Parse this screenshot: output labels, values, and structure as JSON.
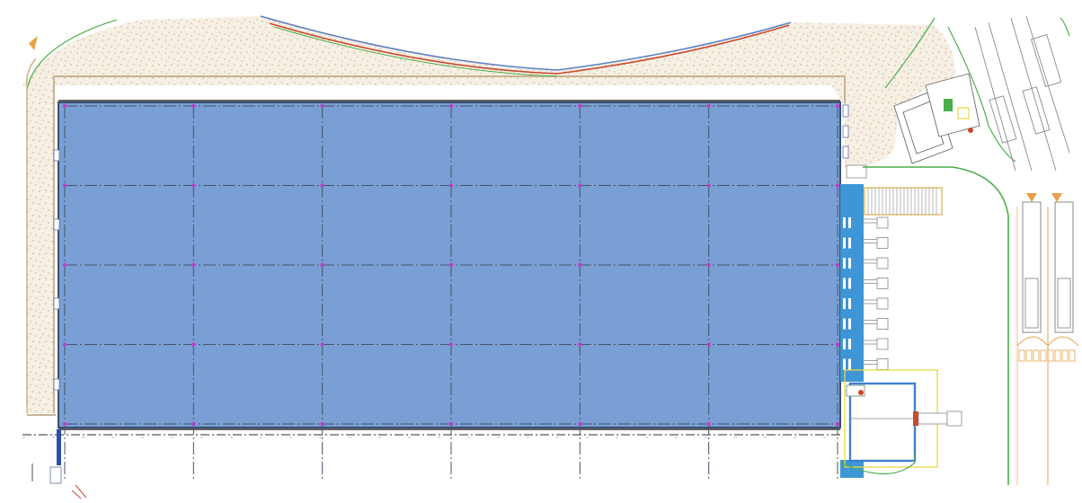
{
  "drawing": {
    "type": "site-plan",
    "grid": {
      "columns": 6,
      "rows": 4
    },
    "dock_doors": 8
  },
  "colors": {
    "building_fill": "#7a9fd4",
    "building_outline": "#3a4f72",
    "gravel_fill": "#f6efe4",
    "gravel_dot": "#c8a070",
    "site_boundary": "#c9b393",
    "grid_line": "#44546a",
    "grid_node": "#c03ec8",
    "dock_apron": "#3f96d6",
    "road_green": "#4aae4a",
    "curb_blue": "#5a7ec8",
    "curb_red": "#c8492e",
    "vehicle": "#8a8a8a",
    "marking_orange": "#e8a048",
    "yellow_boundary": "#e8d840"
  },
  "icons": [
    "north-arrow-icon",
    "fire-hydrant-icon"
  ]
}
